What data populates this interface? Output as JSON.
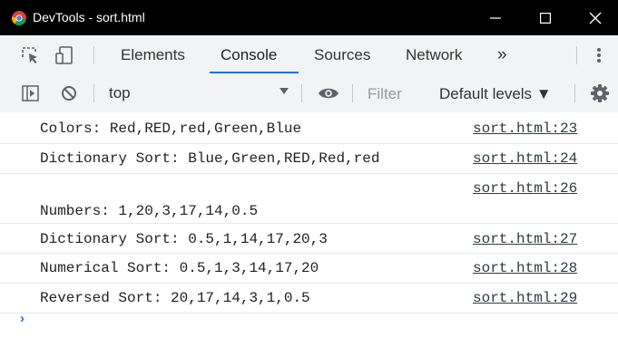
{
  "window": {
    "title": "DevTools - sort.html",
    "controls": [
      "minimize-icon",
      "maximize-icon",
      "close-icon"
    ]
  },
  "tabs": {
    "items": [
      {
        "label": "Elements"
      },
      {
        "label": "Console",
        "active": true
      },
      {
        "label": "Sources"
      },
      {
        "label": "Network"
      }
    ],
    "more": "»"
  },
  "toolbar": {
    "context": "top",
    "filter_placeholder": "Filter",
    "levels_label": "Default levels ▼"
  },
  "console": {
    "rows": [
      {
        "message": "Colors: Red,RED,red,Green,Blue",
        "source": "sort.html:23"
      },
      {
        "message": "Dictionary Sort: Blue,Green,RED,Red,red",
        "source": "sort.html:24"
      },
      {
        "message": "",
        "source": "sort.html:26"
      },
      {
        "message": "Numbers: 1,20,3,17,14,0.5",
        "source": ""
      },
      {
        "message": "Dictionary Sort: 0.5,1,14,17,20,3",
        "source": "sort.html:27"
      },
      {
        "message": "Numerical Sort: 0.5,1,3,14,17,20",
        "source": "sort.html:28"
      },
      {
        "message": "Reversed Sort: 20,17,14,3,1,0.5",
        "source": "sort.html:29"
      }
    ],
    "prompt": "›"
  },
  "colors": {
    "titlebar": "#000000",
    "toolbar_bg": "#f1f3f4",
    "accent": "#1a73e8"
  }
}
